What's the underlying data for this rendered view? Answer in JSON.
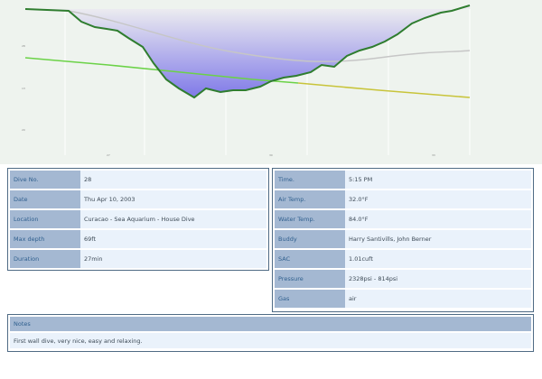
{
  "profile": {
    "ticks": [
      "28",
      "13",
      "20",
      "27",
      "30",
      "33",
      "34",
      "36",
      "63",
      "70",
      "11"
    ],
    "start_label": "",
    "min_label": "",
    "end_label": "",
    "footer_label": "",
    "colors": {
      "depth": "#2f7d2f",
      "area_top": "#d9dbe9",
      "area_bottom": "#8a84ea",
      "temp": "#c6c6c6",
      "pressure": "#6bd247",
      "pressure_end": "#c8c43a"
    }
  },
  "details_left": [
    {
      "label": "Dive No.",
      "value": "28"
    },
    {
      "label": "Date",
      "value": "Thu Apr 10, 2003"
    },
    {
      "label": "Location",
      "value": "Curacao - Sea Aquarium - House Dive"
    },
    {
      "label": "Max depth",
      "value": "69ft"
    },
    {
      "label": "Duration",
      "value": "27min"
    }
  ],
  "details_right": [
    {
      "label": "Time.",
      "value": "5:15 PM"
    },
    {
      "label": "Air Temp.",
      "value": "32.0°F"
    },
    {
      "label": "Water Temp.",
      "value": "84.0°F"
    },
    {
      "label": "Buddy",
      "value": "Harry Santivills, John Berner"
    },
    {
      "label": "SAC",
      "value": "1.01cuft"
    },
    {
      "label": "Pressure",
      "value": "2328psi - 814psi"
    },
    {
      "label": "Gas",
      "value": "air"
    }
  ],
  "notes": {
    "title": "Notes",
    "text": "First wall dive, very nice, easy and relaxing."
  }
}
